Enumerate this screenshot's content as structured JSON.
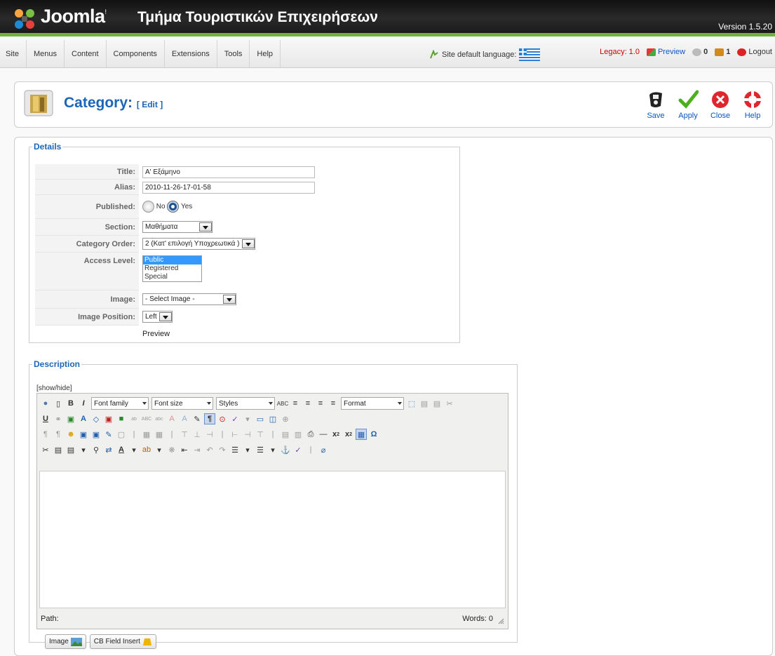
{
  "header": {
    "brand": "Joomla!",
    "brand_main": "Joomla",
    "brand_mark": "!",
    "site_title": "Τμήμα Τουριστικών Επιχειρήσεων",
    "version": "Version 1.5.20"
  },
  "menu": [
    "Site",
    "Menus",
    "Content",
    "Components",
    "Extensions",
    "Tools",
    "Help"
  ],
  "status": {
    "site_default_language": "Site default language:",
    "legacy": "Legacy: 1.0",
    "preview": "Preview",
    "messages_count": "0",
    "users_count": "1",
    "logout": "Logout"
  },
  "toolbar": {
    "title": "Category:",
    "subtitle": "[ Edit ]",
    "buttons": [
      "Save",
      "Apply",
      "Close",
      "Help"
    ]
  },
  "details": {
    "legend": "Details",
    "labels": {
      "title": "Title:",
      "alias": "Alias:",
      "published": "Published:",
      "section": "Section:",
      "category_order": "Category Order:",
      "access_level": "Access Level:",
      "image": "Image:",
      "image_position": "Image Position:"
    },
    "title_value": "Α' Εξάμηνο",
    "alias_value": "2010-11-26-17-01-58",
    "published_no": "No",
    "published_yes": "Yes",
    "published_selected": "Yes",
    "section_value": "Μαθήματα",
    "category_order_value": "2 (Κατ' επιλογή Υποχρεωτικά )",
    "access_options": [
      "Public",
      "Registered",
      "Special"
    ],
    "access_selected": "Public",
    "image_value": "- Select Image -",
    "image_position_value": "Left",
    "preview_label": "Preview"
  },
  "description": {
    "legend": "Description",
    "show_hide": "[show/hide]",
    "font_family": "Font family",
    "font_size": "Font size",
    "styles": "Styles",
    "format": "Format",
    "path_label": "Path:",
    "words_label": "Words: 0",
    "buttons": [
      "Image",
      "CB Field Insert"
    ]
  }
}
